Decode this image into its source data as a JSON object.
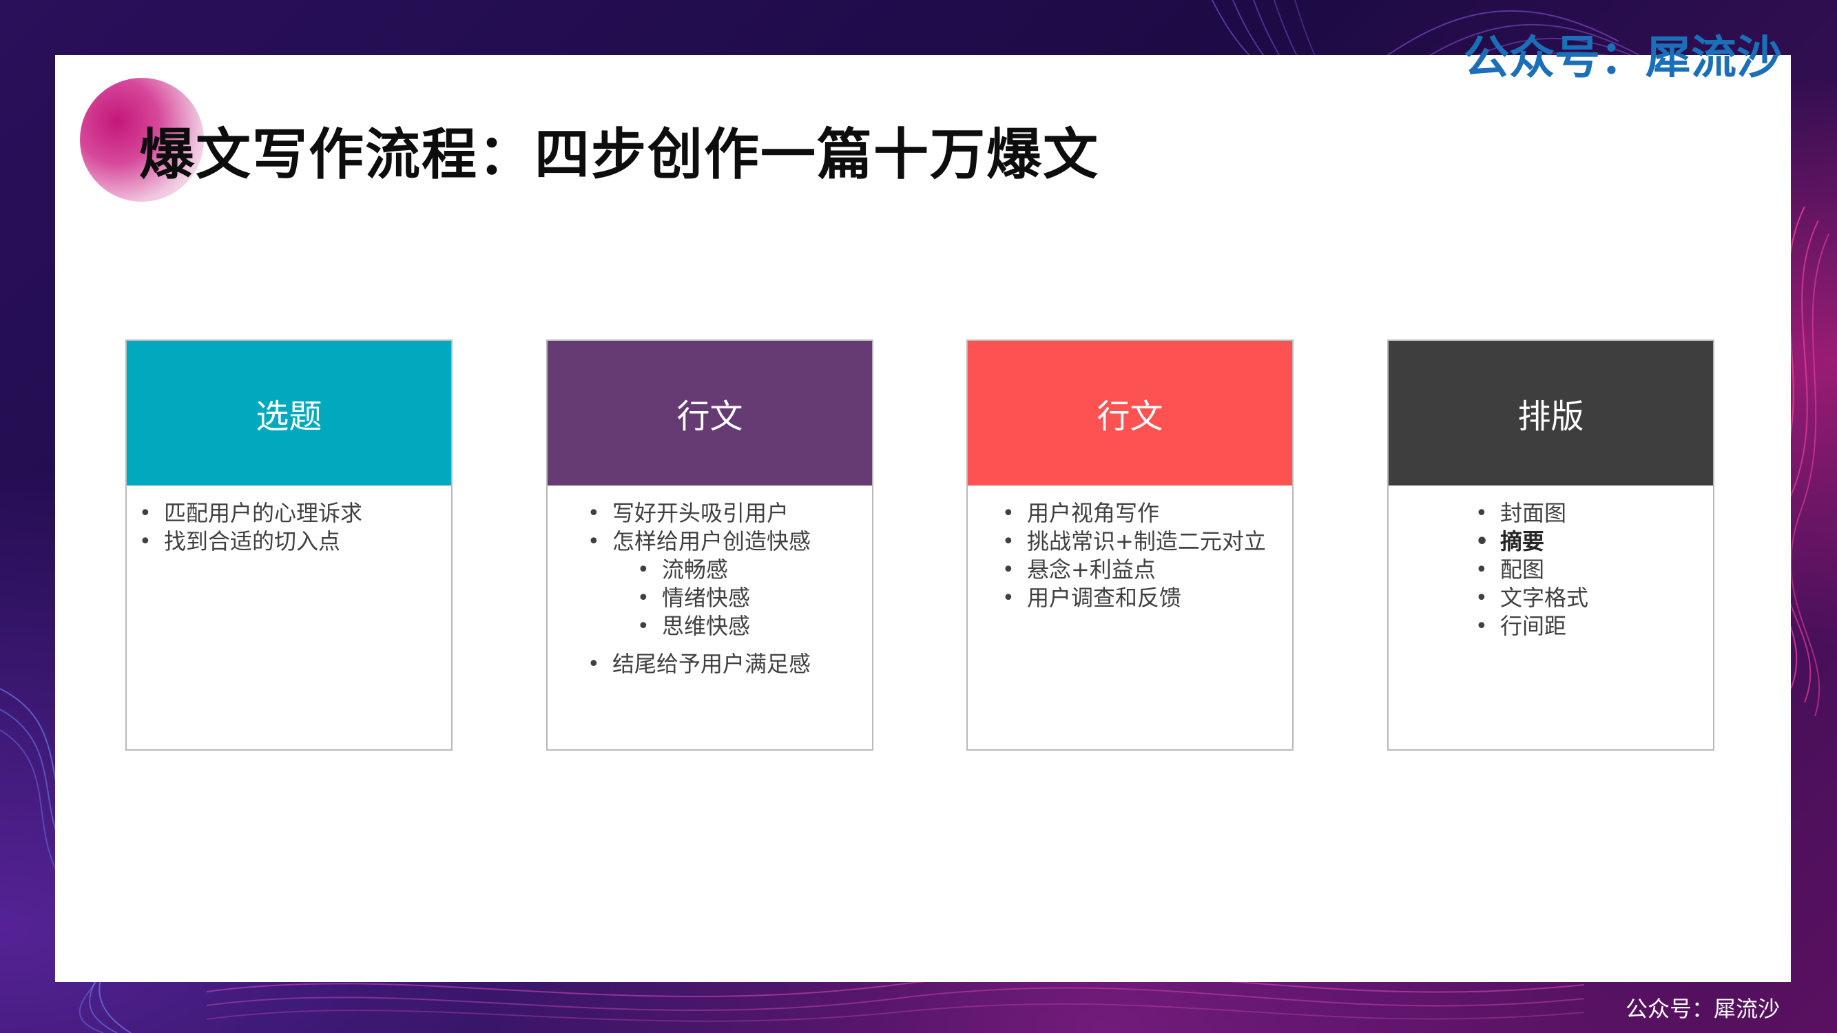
{
  "title": "爆文写作流程：四步创作一篇十万爆文",
  "watermark_top": "公众号：犀流沙",
  "watermark_bottom": "公众号：犀流沙",
  "colors": {
    "card1": "#00a9bd",
    "card2": "#663a73",
    "card3": "#fd5252",
    "card4": "#3e3e3e",
    "watermark_top": "#1a6fb8"
  },
  "cards": [
    {
      "heading": "选题",
      "bullets": [
        "匹配用户的心理诉求",
        "找到合适的切入点"
      ]
    },
    {
      "heading": "行文",
      "bullets": [
        "写好开头吸引用户",
        "怎样给用户创造快感"
      ],
      "sub_bullets": [
        "流畅感",
        "情绪快感",
        "思维快感"
      ],
      "closing_bullet": "结尾给予用户满足感"
    },
    {
      "heading": "行文",
      "bullets": [
        "用户视角写作",
        "挑战常识+制造二元对立",
        "悬念+利益点",
        "用户调查和反馈"
      ]
    },
    {
      "heading": "排版",
      "bullets": [
        "封面图",
        "摘要",
        "配图",
        "文字格式",
        "行间距"
      ]
    }
  ]
}
